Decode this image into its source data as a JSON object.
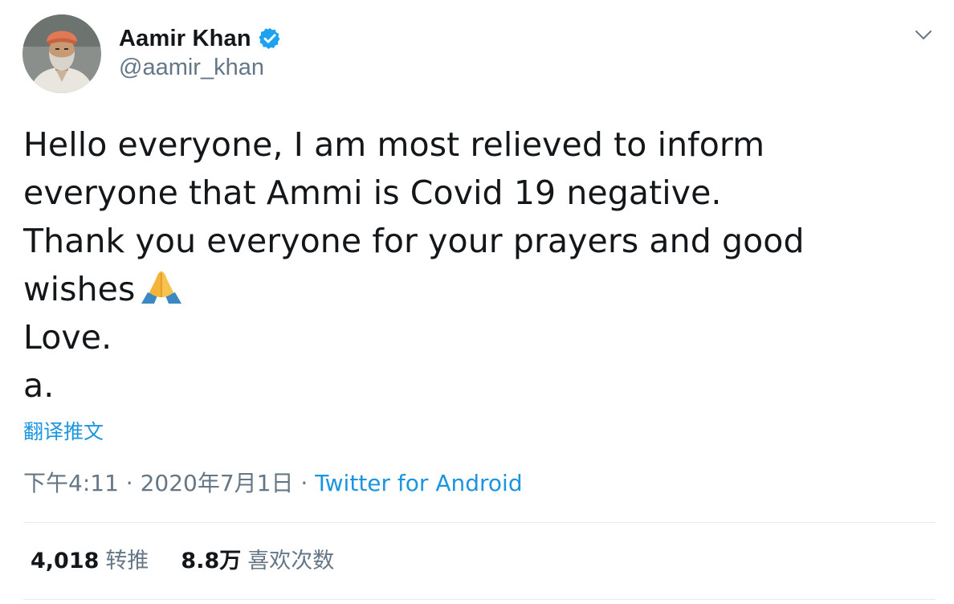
{
  "user": {
    "display_name": "Aamir Khan",
    "handle": "@aamir_khan",
    "verified": true
  },
  "tweet": {
    "lines": [
      "Hello everyone, I am most relieved to inform",
      "everyone that Ammi is Covid 19 negative.",
      "Thank you everyone for your prayers and good",
      "wishes",
      "Love.",
      "a."
    ],
    "emoji": "folded-hands"
  },
  "translate_label": "翻译推文",
  "meta": {
    "time": "下午4:11",
    "separator1": " · ",
    "date": "2020年7月1日",
    "separator2": " · ",
    "source": "Twitter for Android"
  },
  "stats": {
    "retweets_count": "4,018",
    "retweets_label": "转推",
    "likes_count": "8.8万",
    "likes_label": "喜欢次数"
  },
  "icons": {
    "verified": "verified-badge-icon",
    "menu": "chevron-down-icon"
  },
  "colors": {
    "link": "#1b95e0",
    "verified": "#1da1f2",
    "secondary_text": "#657786",
    "primary_text": "#14171a"
  }
}
